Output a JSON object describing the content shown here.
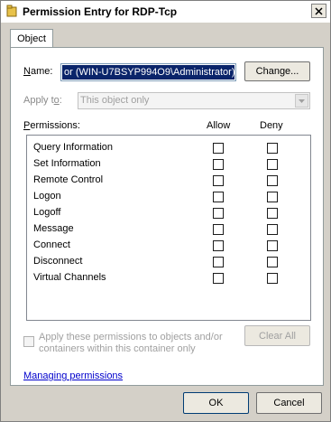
{
  "window": {
    "title": "Permission Entry for RDP-Tcp"
  },
  "tabs": [
    {
      "label": "Object"
    }
  ],
  "name": {
    "label": "Name:",
    "value": "or (WIN-U7BSYP994O9\\Administrator)",
    "change_button": "Change..."
  },
  "apply_to": {
    "label": "Apply to:",
    "value": "This object only",
    "disabled": true
  },
  "permissions": {
    "label": "Permissions:",
    "allow_header": "Allow",
    "deny_header": "Deny",
    "items": [
      {
        "name": "Query Information",
        "allow": false,
        "deny": false
      },
      {
        "name": "Set Information",
        "allow": false,
        "deny": false
      },
      {
        "name": "Remote Control",
        "allow": false,
        "deny": false
      },
      {
        "name": "Logon",
        "allow": false,
        "deny": false
      },
      {
        "name": "Logoff",
        "allow": false,
        "deny": false
      },
      {
        "name": "Message",
        "allow": false,
        "deny": false
      },
      {
        "name": "Connect",
        "allow": false,
        "deny": false
      },
      {
        "name": "Disconnect",
        "allow": false,
        "deny": false
      },
      {
        "name": "Virtual Channels",
        "allow": false,
        "deny": false
      }
    ]
  },
  "apply_inherit": {
    "label": "Apply these permissions to objects and/or containers within this container only",
    "checked": false,
    "disabled": true
  },
  "clear_all_button": "Clear All",
  "managing_link": "Managing permissions",
  "ok_button": "OK",
  "cancel_button": "Cancel",
  "icons": {
    "app": "folder-key-icon",
    "close": "close-icon",
    "dropdown": "chevron-down-icon"
  }
}
